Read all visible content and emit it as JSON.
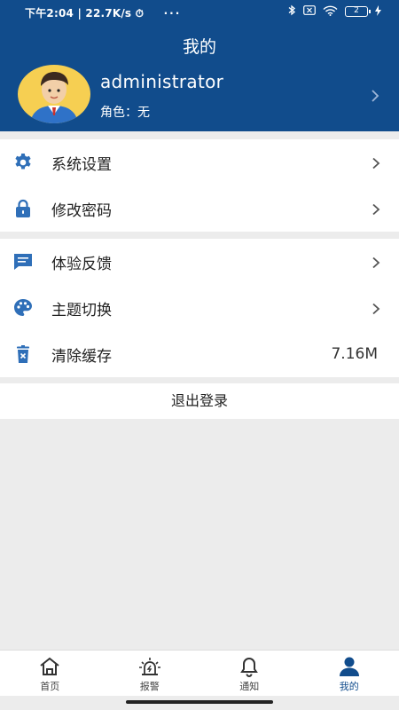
{
  "status_bar": {
    "time": "下午2:04",
    "speed": "22.7K/s",
    "more": "···",
    "battery": "2"
  },
  "header": {
    "title": "我的",
    "username": "administrator",
    "role": "角色：无"
  },
  "menu_group_1": [
    {
      "label": "系统设置",
      "icon": "gear-icon"
    },
    {
      "label": "修改密码",
      "icon": "lock-icon"
    }
  ],
  "menu_group_2": [
    {
      "label": "体验反馈",
      "icon": "chat-icon"
    },
    {
      "label": "主题切换",
      "icon": "palette-icon"
    },
    {
      "label": "清除缓存",
      "icon": "trash-icon",
      "value": "7.16M"
    }
  ],
  "logout_label": "退出登录",
  "tabbar": [
    {
      "label": "首页",
      "icon": "home-icon",
      "active": false
    },
    {
      "label": "报警",
      "icon": "alarm-icon",
      "active": false
    },
    {
      "label": "通知",
      "icon": "bell-icon",
      "active": false
    },
    {
      "label": "我的",
      "icon": "person-icon",
      "active": true
    }
  ],
  "colors": {
    "primary": "#114c8c",
    "icon_blue": "#2f6fb8",
    "avatar_bg": "#f6cf52",
    "page_bg": "#ececec"
  }
}
